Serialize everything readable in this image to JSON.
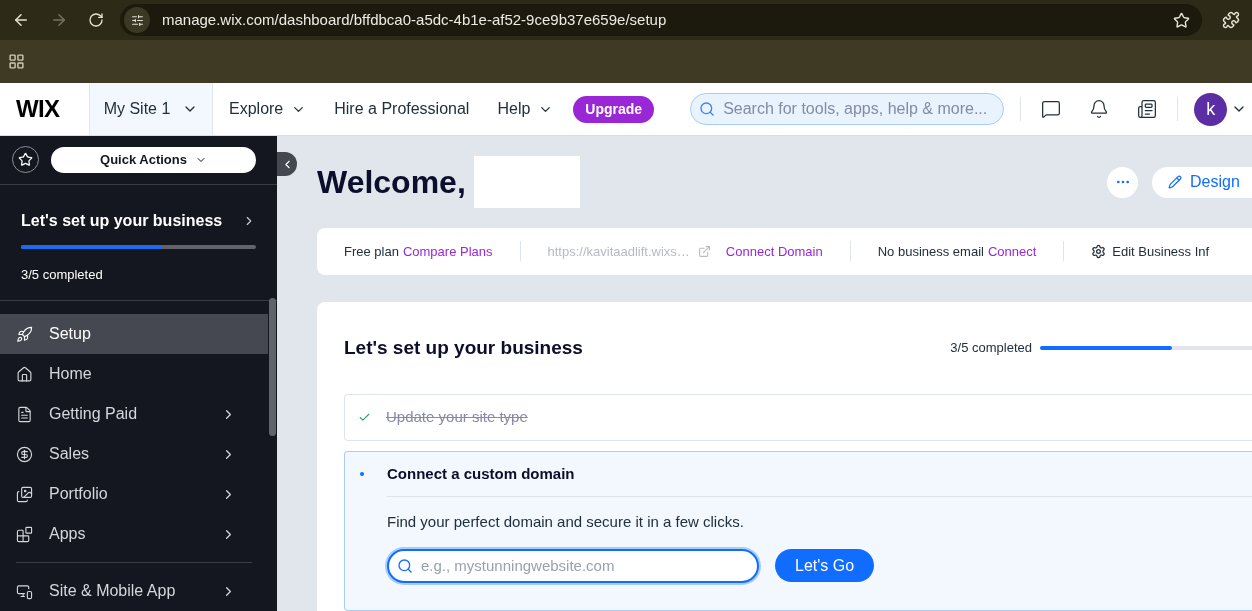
{
  "browser": {
    "url": "manage.wix.com/dashboard/bffdbca0-a5dc-4b1e-af52-9ce9b37e659e/setup",
    "forward_disabled": true
  },
  "topbar": {
    "logo": "WIX",
    "site": "My Site 1",
    "nav": [
      {
        "label": "Explore",
        "dropdown": true
      },
      {
        "label": "Hire a Professional",
        "dropdown": false
      },
      {
        "label": "Help",
        "dropdown": true
      }
    ],
    "upgrade": "Upgrade",
    "search": {
      "placeholder": "Search for tools, apps, help & more..."
    },
    "avatar": "k"
  },
  "sidebar": {
    "quick_actions": "Quick Actions",
    "setup": {
      "title": "Let's set up your business",
      "level": 0.6,
      "progress": "3/5 completed"
    },
    "items": [
      {
        "label": "Setup",
        "selected": true,
        "submenu": false
      },
      {
        "label": "Home",
        "selected": false,
        "submenu": false
      },
      {
        "label": "Getting Paid",
        "selected": false,
        "submenu": true
      },
      {
        "label": "Sales",
        "selected": false,
        "submenu": true
      },
      {
        "label": "Portfolio",
        "selected": false,
        "submenu": true
      },
      {
        "label": "Apps",
        "selected": false,
        "submenu": true
      }
    ],
    "bottom_items": [
      {
        "label": "Site & Mobile App",
        "selected": false,
        "submenu": true
      }
    ]
  },
  "main": {
    "welcome": "Welcome,",
    "design": "Design",
    "info_bar": {
      "plan": "Free plan",
      "compare": "Compare Plans",
      "url": "https://kavitaadlift.wixs…",
      "connect_domain": "Connect Domain",
      "email": "No business email",
      "connect": "Connect",
      "edit": "Edit Business Inf"
    },
    "setup": {
      "title": "Let's set up your business",
      "progress": "3/5 completed",
      "level": 0.6,
      "steps": [
        {
          "kind": "done",
          "title": "Update your site type"
        },
        {
          "kind": "active",
          "title": "Connect a custom domain",
          "description": "Find your perfect domain and secure it in a few clicks.",
          "placeholder": "e.g., mystunningwebsite.com",
          "button": "Let's Go"
        }
      ]
    }
  }
}
